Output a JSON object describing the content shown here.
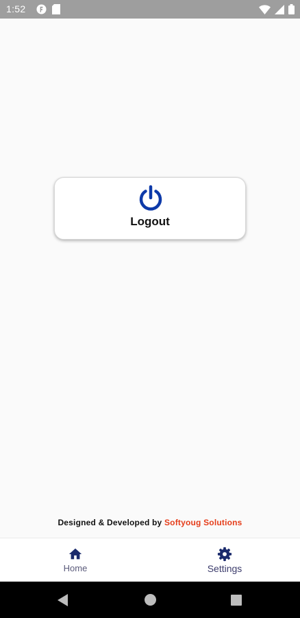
{
  "status_bar": {
    "time": "1:52",
    "icons": [
      "app-notification-icon",
      "sd-card-icon",
      "wifi-icon",
      "signal-icon",
      "battery-icon"
    ]
  },
  "logout_button": {
    "icon": "power-icon",
    "label": "Logout",
    "icon_color": "#0d3aa9"
  },
  "footer": {
    "prefix": "Designed & Developed by",
    "company": "Softyoug Solutions",
    "company_color": "#e53d1a"
  },
  "bottom_nav": {
    "items": [
      {
        "label": "Home",
        "icon": "home-icon"
      },
      {
        "label": "Settings",
        "icon": "gear-icon"
      }
    ],
    "icon_color": "#1a2a6c"
  },
  "system_nav": {
    "buttons": [
      "back-icon",
      "home-circle-icon",
      "recents-icon"
    ]
  }
}
